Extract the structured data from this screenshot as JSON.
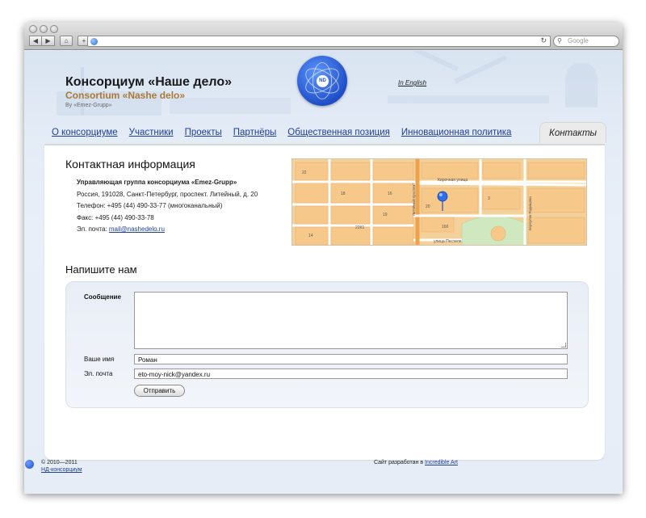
{
  "browser": {
    "nav_back": "◀",
    "nav_forward": "▶",
    "home_icon": "⌂",
    "new_tab_icon": "+",
    "reload_icon": "↻",
    "search_placeholder": "Google"
  },
  "header": {
    "title": "Консорциум «Наше дело»",
    "subtitle": "Consortium «Nashe delo»",
    "by": "By «Emez-Grupp»",
    "logo_text": "ND",
    "lang_link": "In English"
  },
  "tabs": [
    {
      "label": "О консорциуме"
    },
    {
      "label": "Участники"
    },
    {
      "label": "Проекты"
    },
    {
      "label": "Партнёры"
    },
    {
      "label": "Общественная позиция"
    },
    {
      "label": "Инновационная политика"
    },
    {
      "label": "Контакты"
    }
  ],
  "contact": {
    "heading": "Контактная информация",
    "org": "Управляющая группа консорциума «Emez-Grupp»",
    "address": "Россия, 191028, Санкт-Петербург, проспект. Литейный, д. 20",
    "phone": "Телефон: +495 (44) 490-33-77 (многоканальный)",
    "fax": "Факс: +495 (44) 490-33-78",
    "email_label": "Эл. почта:",
    "email": "mail@nashedelo.ru"
  },
  "map": {
    "street1": "Кирочная улица",
    "street2": "улица Пестеля",
    "street3": "Литейный проспект",
    "street4": "переулок Радищева",
    "labels": [
      "22",
      "18",
      "20",
      "16б",
      "3",
      "22К1",
      "19",
      "16",
      "14"
    ]
  },
  "form": {
    "heading": "Напишите нам",
    "message_label": "Сообщение",
    "name_label": "Ваше имя",
    "name_value": "Роман",
    "email_label": "Эл. почта",
    "email_value": "eto-moy-nick@yandex.ru",
    "submit_label": "Отправить"
  },
  "footer": {
    "copyright": "© 2010—2011",
    "org_link": "НД-консорциум",
    "credit_prefix": "Сайт разработан в",
    "credit_link": "Incredible Art"
  },
  "colors": {
    "link": "#1d3f99",
    "subtitle": "#a97a37",
    "logo": "#1f4fc8",
    "map_block": "#f6c98a",
    "map_street": "#ffffff"
  }
}
